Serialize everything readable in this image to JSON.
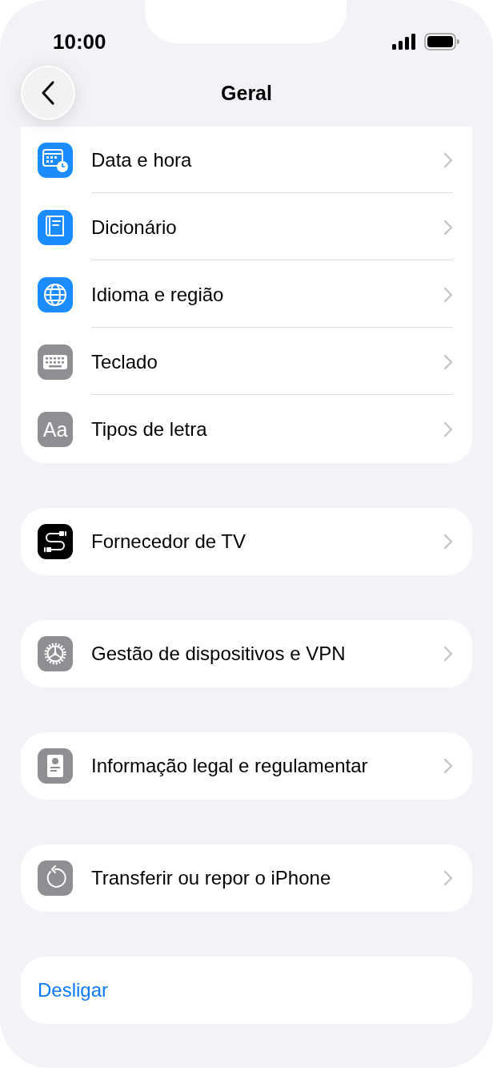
{
  "status_bar": {
    "time": "10:00"
  },
  "header": {
    "title": "Geral"
  },
  "sections": [
    {
      "kind": "list",
      "items": [
        {
          "label": "Data e hora",
          "kind": "calendar",
          "color": "#1a8cff"
        },
        {
          "label": "Dicionário",
          "kind": "book",
          "color": "#1a8cff"
        },
        {
          "label": "Idioma e região",
          "kind": "globe",
          "color": "#1a8cff"
        },
        {
          "label": "Teclado",
          "kind": "keyboard",
          "color": "#8e8e93"
        },
        {
          "label": "Tipos de letra",
          "kind": "text",
          "icon_text": "Aa",
          "color": "#8e8e93"
        }
      ]
    },
    {
      "kind": "list",
      "items": [
        {
          "label": "Fornecedor de TV",
          "kind": "cable",
          "color": "#000000"
        }
      ]
    },
    {
      "kind": "list",
      "items": [
        {
          "label": "Gestão de dispositivos e VPN",
          "kind": "gear",
          "color": "#8e8e93"
        }
      ]
    },
    {
      "kind": "list",
      "items": [
        {
          "label": "Informação legal e regulamentar",
          "kind": "certificate",
          "color": "#8e8e93"
        }
      ]
    },
    {
      "kind": "list",
      "items": [
        {
          "label": "Transferir ou repor o iPhone",
          "kind": "reset",
          "color": "#8e8e93"
        }
      ]
    },
    {
      "kind": "action",
      "items": [
        {
          "label": "Desligar"
        }
      ]
    }
  ]
}
